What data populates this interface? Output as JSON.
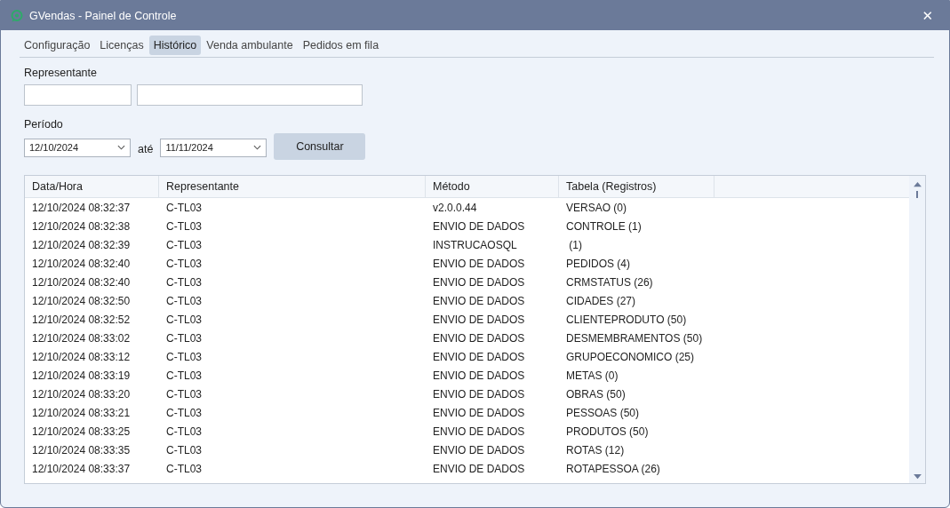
{
  "window": {
    "title": "GVendas - Painel de Controle",
    "close": "✕"
  },
  "tabs": [
    {
      "label": "Configuração",
      "selected": false
    },
    {
      "label": "Licenças",
      "selected": false
    },
    {
      "label": "Histórico",
      "selected": true
    },
    {
      "label": "Venda ambulante",
      "selected": false
    },
    {
      "label": "Pedidos em fila",
      "selected": false
    }
  ],
  "representante": {
    "label": "Representante"
  },
  "periodo": {
    "label": "Período",
    "from": "12/10/2024",
    "to_label": "até",
    "to": "11/11/2024",
    "button": "Consultar"
  },
  "table": {
    "columns": [
      "Data/Hora",
      "Representante",
      "Método",
      "Tabela (Registros)"
    ],
    "rows": [
      [
        "12/10/2024 08:32:37",
        "C-TL03",
        "v2.0.0.44",
        "VERSAO (0)"
      ],
      [
        "12/10/2024 08:32:38",
        "C-TL03",
        "ENVIO DE DADOS",
        "CONTROLE (1)"
      ],
      [
        "12/10/2024 08:32:39",
        "C-TL03",
        "INSTRUCAOSQL",
        " (1)"
      ],
      [
        "12/10/2024 08:32:40",
        "C-TL03",
        "ENVIO DE DADOS",
        "PEDIDOS (4)"
      ],
      [
        "12/10/2024 08:32:40",
        "C-TL03",
        "ENVIO DE DADOS",
        "CRMSTATUS (26)"
      ],
      [
        "12/10/2024 08:32:50",
        "C-TL03",
        "ENVIO DE DADOS",
        "CIDADES (27)"
      ],
      [
        "12/10/2024 08:32:52",
        "C-TL03",
        "ENVIO DE DADOS",
        "CLIENTEPRODUTO (50)"
      ],
      [
        "12/10/2024 08:33:02",
        "C-TL03",
        "ENVIO DE DADOS",
        "DESMEMBRAMENTOS (50)"
      ],
      [
        "12/10/2024 08:33:12",
        "C-TL03",
        "ENVIO DE DADOS",
        "GRUPOECONOMICO (25)"
      ],
      [
        "12/10/2024 08:33:19",
        "C-TL03",
        "ENVIO DE DADOS",
        "METAS (0)"
      ],
      [
        "12/10/2024 08:33:20",
        "C-TL03",
        "ENVIO DE DADOS",
        "OBRAS (50)"
      ],
      [
        "12/10/2024 08:33:21",
        "C-TL03",
        "ENVIO DE DADOS",
        "PESSOAS (50)"
      ],
      [
        "12/10/2024 08:33:25",
        "C-TL03",
        "ENVIO DE DADOS",
        "PRODUTOS (50)"
      ],
      [
        "12/10/2024 08:33:35",
        "C-TL03",
        "ENVIO DE DADOS",
        "ROTAS (12)"
      ],
      [
        "12/10/2024 08:33:37",
        "C-TL03",
        "ENVIO DE DADOS",
        "ROTAPESSOA (26)"
      ]
    ]
  }
}
